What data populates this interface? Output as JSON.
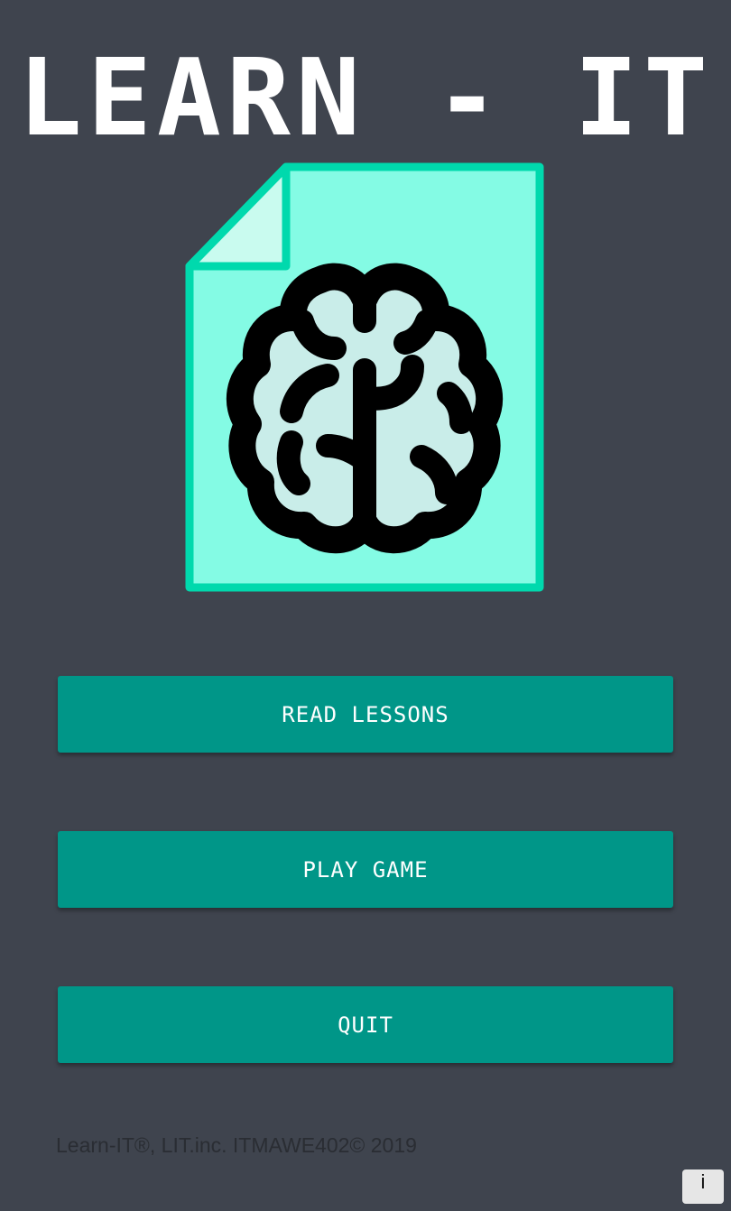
{
  "app": {
    "title": "LEARN - IT"
  },
  "logo": {
    "icon": "brain-document-icon",
    "colors": {
      "paper": "#84fbe4",
      "paper_border": "#00d9ad",
      "brain_fill": "#c9ede9",
      "brain_outline": "#000000"
    }
  },
  "menu": {
    "buttons": [
      {
        "label": "READ LESSONS"
      },
      {
        "label": "PLAY GAME"
      },
      {
        "label": "QUIT"
      }
    ]
  },
  "footer": {
    "text": "Learn-IT®, LIT.inc. ITMAWE402© 2019"
  },
  "info": {
    "label": "i"
  },
  "colors": {
    "background": "#3f444e",
    "button": "#009688",
    "button_text": "#ffffff"
  }
}
